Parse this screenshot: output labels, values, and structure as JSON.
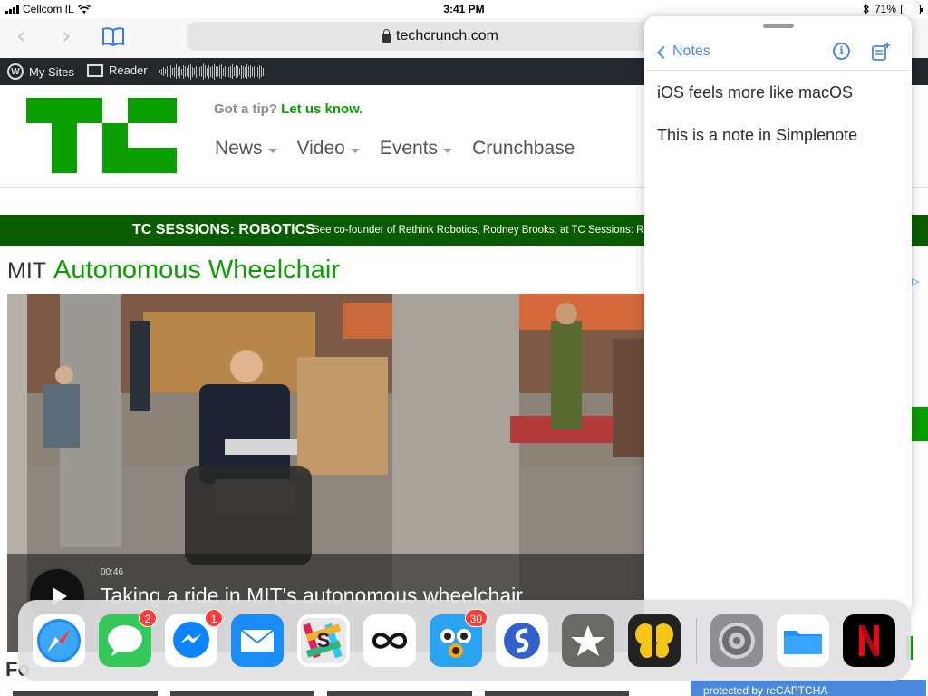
{
  "status_bar": {
    "carrier": "Cellcom IL",
    "time": "3:41 PM",
    "battery_percent": "71%",
    "battery_level": 0.71
  },
  "browser": {
    "url": "techcrunch.com",
    "back_icon": "chevron-left-icon",
    "forward_icon": "chevron-right-icon",
    "bookmarks_icon": "book-icon"
  },
  "wp_bar": {
    "my_sites": "My Sites",
    "reader": "Reader"
  },
  "tc": {
    "tip_text": "Got a tip?",
    "tip_link": "Let us know.",
    "nav": [
      {
        "label": "News",
        "has_dropdown": true
      },
      {
        "label": "Video",
        "has_dropdown": true
      },
      {
        "label": "Events",
        "has_dropdown": true
      },
      {
        "label": "Crunchbase",
        "has_dropdown": false
      }
    ],
    "banner_title": "TC SESSIONS: ROBOTICS",
    "banner_text": "See co-founder of Rethink Robotics, Rodney Brooks, at TC Sessions: Rob",
    "headline_tag": "MIT",
    "headline_title": "Autonomous Wheelchair",
    "video_duration": "00:46",
    "video_title": "Taking a ride in MIT's autonomous wheelchair",
    "below_text": "Fo",
    "recaptcha": "protected by reCAPTCHA"
  },
  "notes_panel": {
    "back_label": "Notes",
    "info_icon": "info-icon",
    "new_note_icon": "new-note-icon",
    "lines": [
      "iOS feels more like macOS",
      "This is a note in Simplenote"
    ]
  },
  "dock": {
    "apps": [
      {
        "name": "Safari",
        "icon": "safari-icon",
        "badge": ""
      },
      {
        "name": "Messages",
        "icon": "messages-icon",
        "badge": "2"
      },
      {
        "name": "Messenger",
        "icon": "messenger-icon",
        "badge": "1"
      },
      {
        "name": "Mail",
        "icon": "mail-icon",
        "badge": ""
      },
      {
        "name": "Slack",
        "icon": "slack-icon",
        "badge": ""
      },
      {
        "name": "Infinity",
        "icon": "infinity-icon",
        "badge": ""
      },
      {
        "name": "Tweetbot",
        "icon": "tweetbot-icon",
        "badge": "30"
      },
      {
        "name": "Simplenote",
        "icon": "simplenote-icon",
        "badge": ""
      },
      {
        "name": "Reeder",
        "icon": "star-icon",
        "badge": ""
      },
      {
        "name": "Tes",
        "icon": "butterfly-icon",
        "badge": ""
      },
      {
        "name": "Settings",
        "icon": "settings-gear-icon",
        "badge": ""
      },
      {
        "name": "Files",
        "icon": "files-folder-icon",
        "badge": ""
      },
      {
        "name": "Netflix",
        "icon": "netflix-icon",
        "badge": ""
      }
    ]
  },
  "colors": {
    "tc_green": "#0a9e01",
    "banner_green": "#0a5c00",
    "link_blue": "#4a89dc",
    "badge_red": "#fc3d39"
  }
}
